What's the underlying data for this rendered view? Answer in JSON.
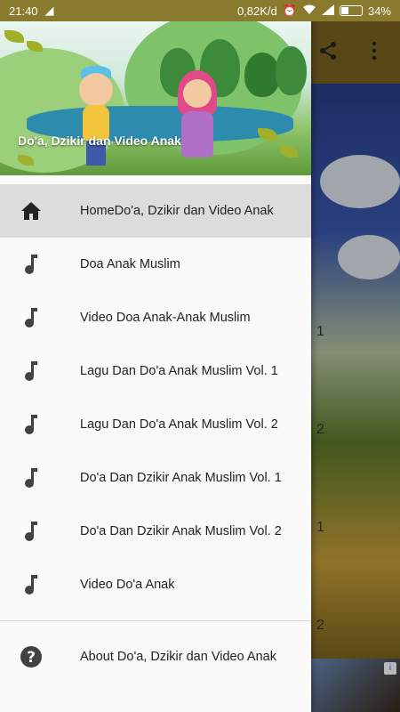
{
  "status_bar": {
    "time": "21:40",
    "network_speed": "0,82K/d",
    "battery": "34%",
    "battery_level": 0.34
  },
  "drawer": {
    "header_title": "Do'a, Dzikir dan Video Anak",
    "items": [
      {
        "label": "HomeDo'a, Dzikir dan Video Anak",
        "icon": "home-icon",
        "active": true
      },
      {
        "label": "Doa Anak Muslim",
        "icon": "music-note-icon"
      },
      {
        "label": "Video Doa Anak-Anak Muslim",
        "icon": "music-note-icon"
      },
      {
        "label": "Lagu Dan Do'a Anak Muslim Vol. 1",
        "icon": "music-note-icon"
      },
      {
        "label": "Lagu Dan Do'a Anak Muslim Vol. 2",
        "icon": "music-note-icon"
      },
      {
        "label": "Do'a Dan Dzikir Anak Muslim Vol. 1",
        "icon": "music-note-icon"
      },
      {
        "label": "Do'a Dan Dzikir Anak Muslim Vol. 2",
        "icon": "music-note-icon"
      },
      {
        "label": "Video Do'a Anak",
        "icon": "music-note-icon"
      }
    ],
    "about": {
      "label": "About Do'a, Dzikir dan Video Anak",
      "icon": "help-icon"
    }
  },
  "background": {
    "visible_numbers": [
      "1",
      "2",
      "1",
      "2"
    ]
  },
  "colors": {
    "status_bar": "#8a7a2e",
    "active_item": "#dcdcdc",
    "icon": "#424242"
  }
}
